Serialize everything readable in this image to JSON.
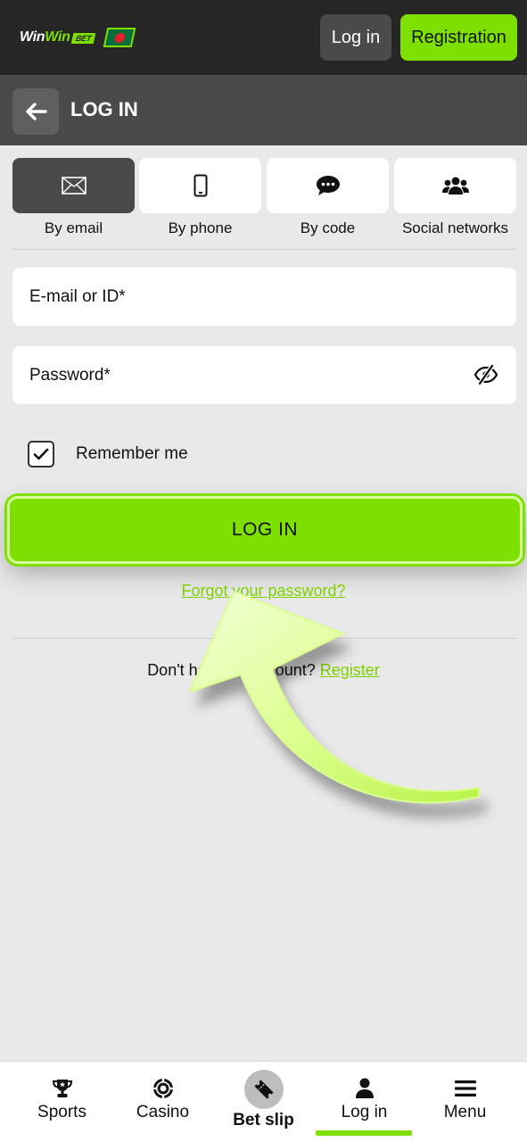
{
  "header": {
    "logo": {
      "word1": "Win",
      "word2": "Win",
      "badge": "BET"
    },
    "flag_icon": "bangladesh-flag-icon",
    "login_label": "Log in",
    "registration_label": "Registration",
    "colors": {
      "bar": "#262626",
      "accent": "#7ee000"
    }
  },
  "subheader": {
    "back_icon": "arrow-left-icon",
    "title": "LOG IN"
  },
  "methods": [
    {
      "label": "By email",
      "icon": "envelope-icon",
      "active": true
    },
    {
      "label": "By phone",
      "icon": "phone-icon",
      "active": false
    },
    {
      "label": "By code",
      "icon": "chat-bubble-icon",
      "active": false
    },
    {
      "label": "Social networks",
      "icon": "users-icon",
      "active": false
    }
  ],
  "form": {
    "email_placeholder": "E-mail or ID*",
    "password_placeholder": "Password*",
    "password_icon": "eye-slash-icon",
    "remember_label": "Remember me",
    "remember_checked": true,
    "login_button": "LOG IN",
    "forgot_link": "Forgot your password?",
    "no_account_text": "Don't have an account? ",
    "register_link": "Register"
  },
  "bottom_nav": [
    {
      "label": "Sports",
      "icon": "trophy-icon"
    },
    {
      "label": "Casino",
      "icon": "casino-chip-icon"
    },
    {
      "label": "Bet slip",
      "icon": "ticket-icon"
    },
    {
      "label": "Log in",
      "icon": "user-icon",
      "active": true
    },
    {
      "label": "Menu",
      "icon": "hamburger-icon"
    }
  ],
  "overlay": {
    "icon": "pointing-arrow-icon"
  }
}
